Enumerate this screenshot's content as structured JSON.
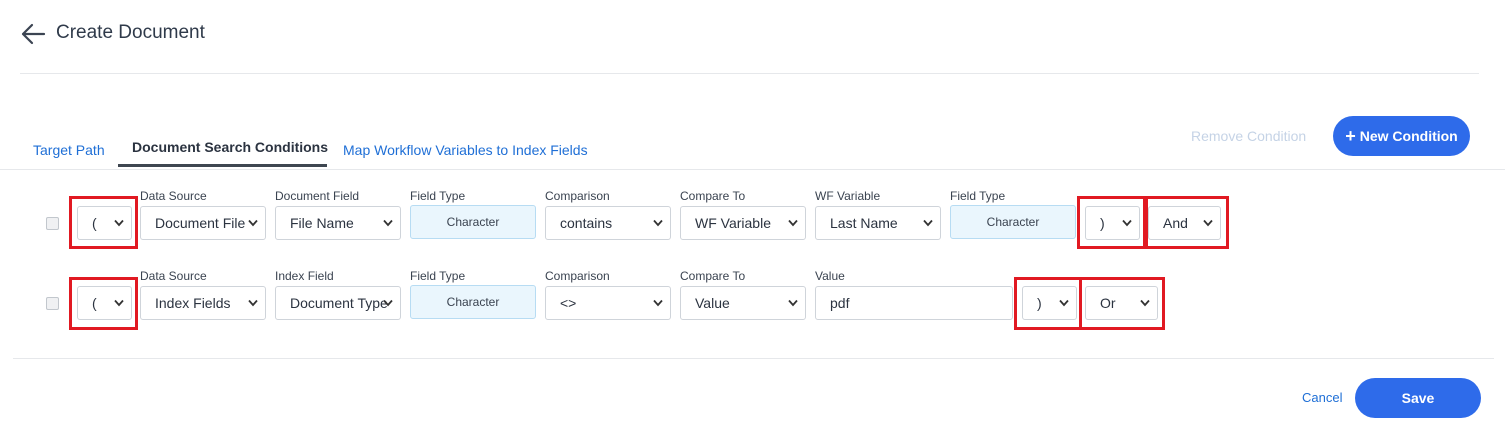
{
  "header": {
    "title": "Create Document",
    "back_icon": "arrow-left-icon"
  },
  "tabs": [
    {
      "label": "Target Path",
      "active": false
    },
    {
      "label": "Document Search Conditions",
      "active": true
    },
    {
      "label": "Map Workflow Variables to Index Fields",
      "active": false
    }
  ],
  "actions": {
    "remove_condition": "Remove Condition",
    "new_condition": "New Condition",
    "cancel": "Cancel",
    "save": "Save"
  },
  "rows": [
    {
      "open_paren": "(",
      "labels": {
        "data_source": "Data Source",
        "field": "Document Field",
        "field_type": "Field Type",
        "comparison": "Comparison",
        "compare_to": "Compare To",
        "target": "WF Variable",
        "target_type": "Field Type"
      },
      "data_source": "Document File",
      "field": "File Name",
      "field_type": "Character",
      "comparison": "contains",
      "compare_to": "WF Variable",
      "target": "Last Name",
      "target_type": "Character",
      "close_paren": ")",
      "logic": "And"
    },
    {
      "open_paren": "(",
      "labels": {
        "data_source": "Data Source",
        "field": "Index Field",
        "field_type": "Field Type",
        "comparison": "Comparison",
        "compare_to": "Compare To",
        "value": "Value"
      },
      "data_source": "Index Fields",
      "field": "Document Type",
      "field_type": "Character",
      "comparison": "<>",
      "compare_to": "Value",
      "value": "pdf",
      "close_paren": ")",
      "logic": "Or"
    }
  ],
  "colors": {
    "primary": "#2e6bea",
    "link": "#1f6fd6",
    "highlight": "#e11922",
    "badge_bg": "#eaf6fd"
  }
}
